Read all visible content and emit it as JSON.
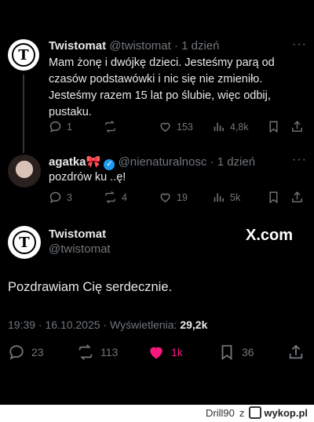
{
  "tweet1": {
    "display_name": "Twistomat",
    "handle": "@twistomat",
    "time": "· 1 dzień",
    "text": "Mam żonę i dwójkę dzieci. Jesteśmy parą od czasów podstawówki i nic się nie zmieniło. Jesteśmy razem 15 lat po ślubie, więc odbij, pustaku.",
    "replies": "1",
    "likes": "153",
    "views": "4,8k",
    "more": "···"
  },
  "tweet2": {
    "display_name": "agatka",
    "emoji": "🎀",
    "handle": "@nienaturalnosc",
    "time": "· 1 dzień",
    "text": "pozdrów ku  ..ę!",
    "replies": "3",
    "retweets": "4",
    "likes": "19",
    "views": "5k",
    "more": "···"
  },
  "main": {
    "display_name": "Twistomat",
    "handle": "@twistomat",
    "brand": "X.com",
    "text": "Pozdrawiam Cię serdecznie.",
    "timestamp": "19:39 · 16.10.2025 · Wyświetlenia:",
    "views": "29,2k",
    "replies": "23",
    "retweets": "113",
    "likes": "1k",
    "bookmarks": "36"
  },
  "footer": {
    "user": "Drill90",
    "letter": "z",
    "site": "wykop.pl"
  },
  "colors": {
    "like_active": "#f91880",
    "verified": "#1d9bf0"
  }
}
